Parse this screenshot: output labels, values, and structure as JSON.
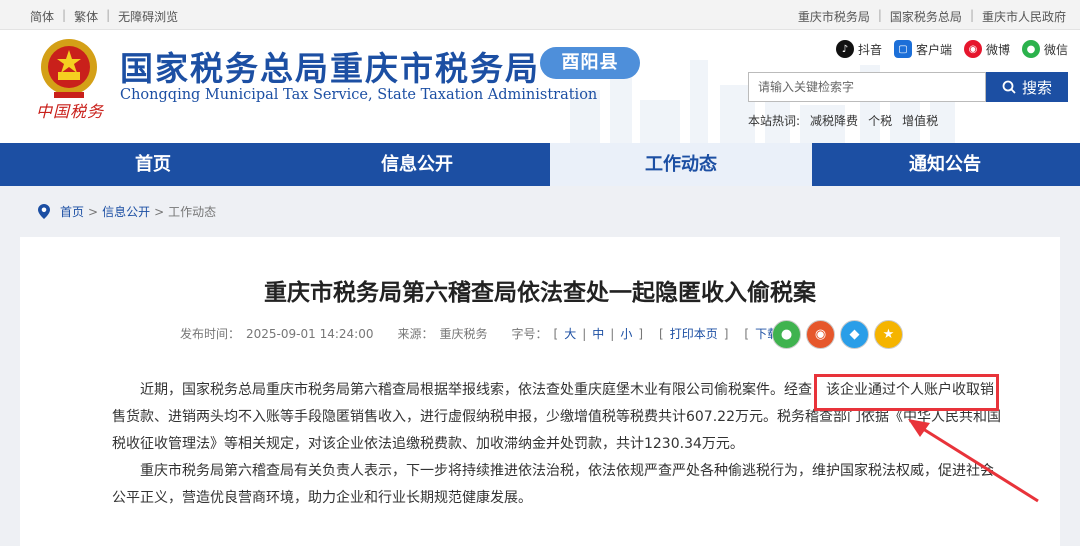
{
  "topbar": {
    "left": [
      "简体",
      "繁体",
      "无障碍浏览"
    ],
    "right": [
      "重庆市税务局",
      "国家税务总局",
      "重庆市人民政府"
    ]
  },
  "header": {
    "emblem_text": "中国税务",
    "title": "国家税务总局重庆市税务局",
    "subtitle": "Chongqing Municipal Tax Service, State Taxation Administration",
    "county": "酉阳县",
    "social": [
      {
        "label": "抖音",
        "icon": "douyin-icon",
        "color": "#111111"
      },
      {
        "label": "客户端",
        "icon": "client-app-icon",
        "color": "#1c6fd8"
      },
      {
        "label": "微博",
        "icon": "weibo-icon",
        "color": "#e6162d"
      },
      {
        "label": "微信",
        "icon": "wechat-icon",
        "color": "#2bb24c"
      }
    ],
    "search_placeholder": "请输入关键检索字",
    "search_button": "搜索",
    "hot_label": "本站热词:",
    "hot_words": [
      "减税降费",
      "个税",
      "增值税"
    ]
  },
  "nav": {
    "tabs": [
      "首页",
      "信息公开",
      "工作动态",
      "通知公告"
    ],
    "active_index": 2
  },
  "breadcrumb": [
    "首页",
    "信息公开",
    "工作动态"
  ],
  "article": {
    "title": "重庆市税务局第六稽查局依法查处一起隐匿收入偷税案",
    "publish_label": "发布时间：",
    "publish_time": "2025-09-01 14:24:00",
    "source_label": "来源：",
    "source": "重庆税务",
    "font_label": "字号：",
    "font_sizes": [
      "大",
      "中",
      "小"
    ],
    "print": "打印本页",
    "close": "下载",
    "paragraph1": "近期，国家税务总局重庆市税务局第六稽查局根据举报线索，依法查处重庆庭堡木业有限公司偷税案件。经查，该企业通过个人账户收取销售货款、进销两头均不入账等手段隐匿销售收入，进行虚假纳税申报，少缴增值税等税费共计607.22万元。税务稽查部门依据《中华人民共和国税收征收管理法》等相关规定，对该企业依法追缴税费款、加收滞纳金并处罚款，共计1230.34万元。",
    "paragraph2": "重庆市税务局第六稽查局有关负责人表示，下一步将持续推进依法治税，依法依规严查严处各种偷逃税行为，维护国家税法权威，促进社会公平正义，营造优良营商环境，助力企业和行业长期规范健康发展。"
  },
  "colors": {
    "brand_blue": "#1c4fa3",
    "highlight_red": "#e8333a"
  }
}
